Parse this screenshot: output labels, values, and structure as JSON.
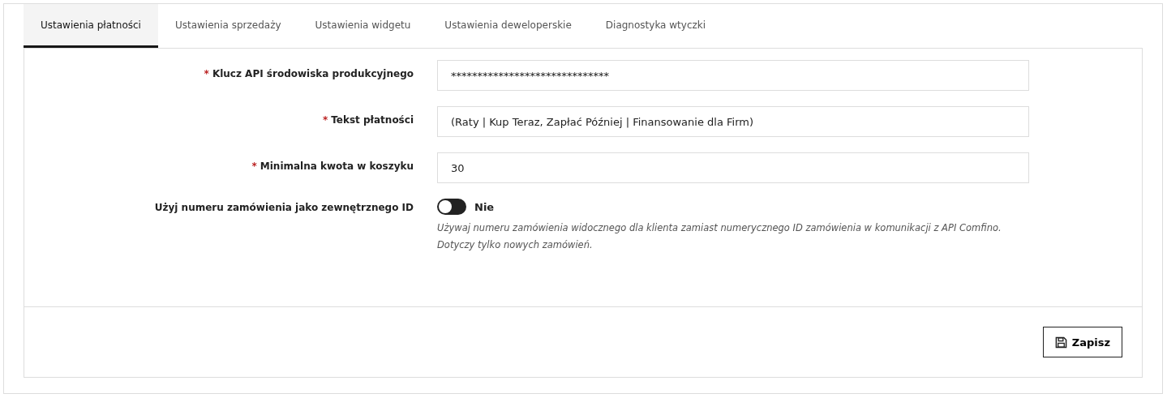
{
  "tabs": [
    {
      "label": "Ustawienia płatności",
      "selected": true
    },
    {
      "label": "Ustawienia sprzedaży",
      "selected": false
    },
    {
      "label": "Ustawienia widgetu",
      "selected": false
    },
    {
      "label": "Ustawienia deweloperskie",
      "selected": false
    },
    {
      "label": "Diagnostyka wtyczki",
      "selected": false
    }
  ],
  "fields": [
    {
      "kind": "text",
      "label": "Klucz API środowiska produkcyjnego",
      "required_mark": "*",
      "value": "******************************"
    },
    {
      "kind": "text",
      "label": "Tekst płatności",
      "required_mark": "*",
      "value": "(Raty | Kup Teraz, Zapłać Później | Finansowanie dla Firm)"
    },
    {
      "kind": "text",
      "label": "Minimalna kwota w koszyku",
      "required_mark": "*",
      "value": "30"
    },
    {
      "kind": "toggle",
      "label": "Użyj numeru zamówienia jako zewnętrznego ID",
      "on": false,
      "state_label": "Nie",
      "help": "Używaj numeru zamówienia widocznego dla klienta zamiast numerycznego ID zamówienia w komunikacji z API Comfino. Dotyczy tylko nowych zamówień."
    }
  ],
  "save_button": "Zapisz"
}
